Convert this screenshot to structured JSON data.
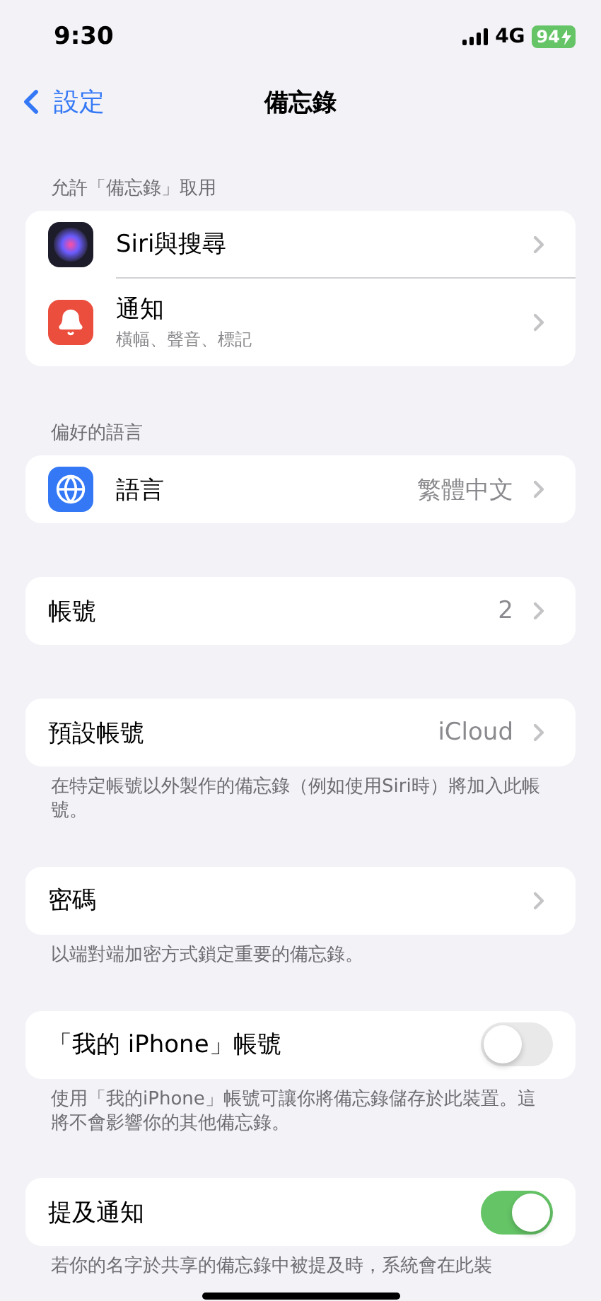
{
  "status_bar": {
    "time": "9:30",
    "network": "4G",
    "battery": "94",
    "charging": true
  },
  "nav": {
    "back": "設定",
    "title": "備忘錄"
  },
  "sections": [
    {
      "header": "允許「備忘錄」取用",
      "rows": [
        {
          "kind": "link",
          "label": "Siri與搜尋"
        },
        {
          "kind": "link",
          "label": "通知",
          "subtitle": "橫幅、聲音、標記"
        }
      ]
    },
    {
      "header": "偏好的語言",
      "rows": [
        {
          "kind": "link",
          "label": "語言",
          "value": "繁體中文"
        }
      ]
    },
    {
      "rows": [
        {
          "kind": "link",
          "label": "帳號",
          "value": "2"
        }
      ]
    },
    {
      "rows": [
        {
          "kind": "link",
          "label": "預設帳號",
          "value": "iCloud"
        }
      ],
      "footer": "在特定帳號以外製作的備忘錄（例如使用Siri時）將加入此帳號。"
    },
    {
      "rows": [
        {
          "kind": "link",
          "label": "密碼"
        }
      ],
      "footer": "以端對端加密方式鎖定重要的備忘錄。"
    },
    {
      "rows": [
        {
          "kind": "toggle",
          "label": "「我的 iPhone」帳號",
          "on": false
        }
      ],
      "footer": "使用「我的iPhone」帳號可讓你將備忘錄儲存於此裝置。這將不會影響你的其他備忘錄。"
    },
    {
      "rows": [
        {
          "kind": "toggle",
          "label": "提及通知",
          "on": true
        }
      ],
      "footer": "若你的名字於共享的備忘錄中被提及時，系統會在此裝"
    }
  ]
}
